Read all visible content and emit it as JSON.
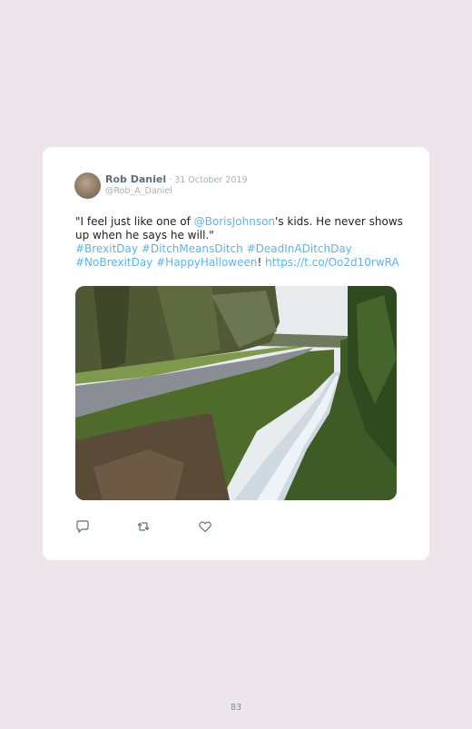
{
  "tweet": {
    "author_name": "Rob Daniel",
    "separator": " · ",
    "date": "31 October 2019",
    "handle": "@Rob_A_Daniel",
    "text": {
      "t1": "\"I feel just like one of ",
      "mention": "@BorisJohnson",
      "t2": "'s kids. He never shows up when he says he will.\"",
      "tag1": "#BrexitDay",
      "tag2": "#DitchMeansDitch",
      "tag3": "#DeadInADitchDay",
      "tag4": "#NoBrexitDay",
      "tag5": "#HappyHalloween",
      "t3": "! ",
      "link": "https://t.co/Oo2d10rwRA"
    },
    "actions": {
      "reply": "reply-icon",
      "retweet": "retweet-icon",
      "like": "heart-icon"
    }
  },
  "page_number": "83",
  "colors": {
    "background": "#ece6ec",
    "card": "#ffffff",
    "link": "#5cb3ea",
    "name": "#5b6f7c",
    "meta": "#a6b1b8"
  }
}
